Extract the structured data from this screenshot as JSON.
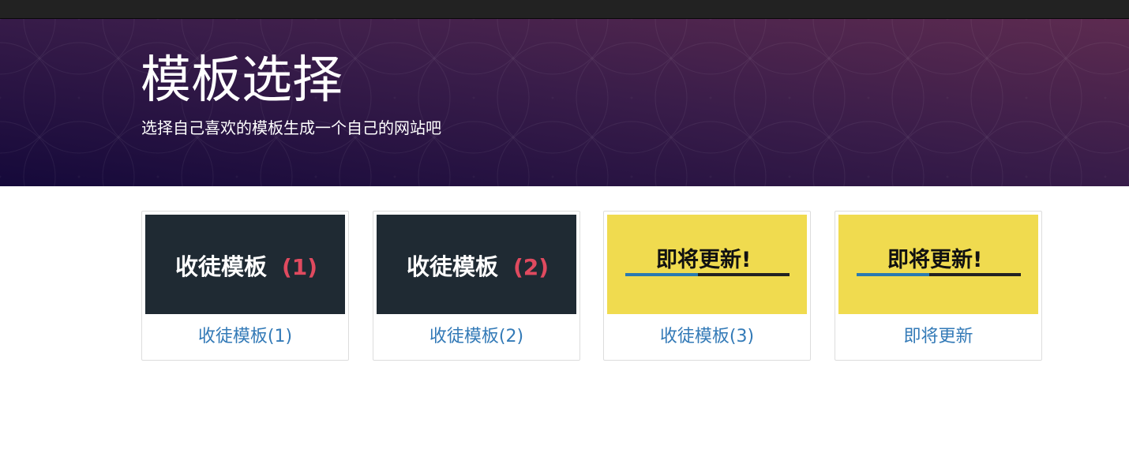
{
  "hero": {
    "title": "模板选择",
    "subtitle": "选择自己喜欢的模板生成一个自己的网站吧"
  },
  "cards": [
    {
      "thumb_text": "收徒模板",
      "thumb_badge": "(1)",
      "label": "收徒模板(1)",
      "style": "dark"
    },
    {
      "thumb_text": "收徒模板",
      "thumb_badge": "(2)",
      "label": "收徒模板(2)",
      "style": "dark"
    },
    {
      "thumb_text": "即将更新!",
      "label": "收徒模板(3)",
      "style": "yellow"
    },
    {
      "thumb_text": "即将更新!",
      "label": "即将更新",
      "style": "yellow"
    }
  ],
  "colors": {
    "topbar": "#222222",
    "hero_start": "#1a0b3b",
    "hero_end": "#5a2a4e",
    "dark_thumb": "#1f2a33",
    "badge_red": "#e04a5f",
    "yellow_thumb": "#f0db4f",
    "link_blue": "#337ab7",
    "bar_blue": "#2a7ab0",
    "bar_dark": "#222222"
  }
}
